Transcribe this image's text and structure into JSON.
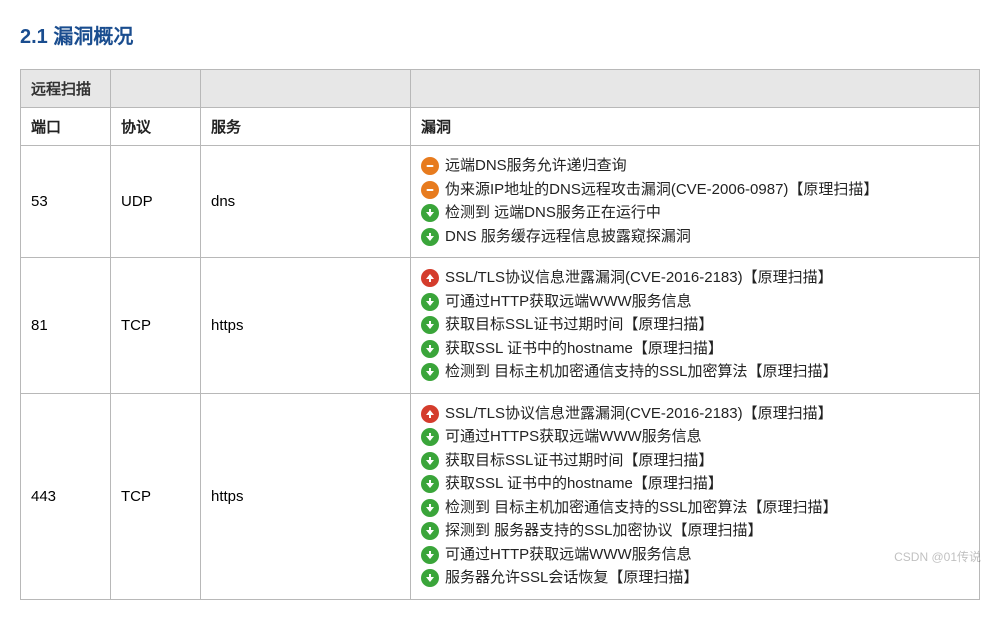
{
  "title": "2.1 漏洞概况",
  "headers": {
    "remote_scan": "远程扫描",
    "port": "端口",
    "protocol": "协议",
    "service": "服务",
    "vuln": "漏洞"
  },
  "rows": [
    {
      "port": "53",
      "protocol": "UDP",
      "service": "dns",
      "vulns": [
        {
          "sev": "orange",
          "text": "远端DNS服务允许递归查询"
        },
        {
          "sev": "orange",
          "text": "伪来源IP地址的DNS远程攻击漏洞(CVE-2006-0987)【原理扫描】"
        },
        {
          "sev": "green",
          "text": "检测到 远端DNS服务正在运行中"
        },
        {
          "sev": "green",
          "text": "DNS 服务缓存远程信息披露窥探漏洞"
        }
      ]
    },
    {
      "port": "81",
      "protocol": "TCP",
      "service": "https",
      "vulns": [
        {
          "sev": "red",
          "text": "SSL/TLS协议信息泄露漏洞(CVE-2016-2183)【原理扫描】"
        },
        {
          "sev": "green",
          "text": "可通过HTTP获取远端WWW服务信息"
        },
        {
          "sev": "green",
          "text": "获取目标SSL证书过期时间【原理扫描】"
        },
        {
          "sev": "green",
          "text": "获取SSL 证书中的hostname【原理扫描】"
        },
        {
          "sev": "green",
          "text": "检测到 目标主机加密通信支持的SSL加密算法【原理扫描】"
        }
      ]
    },
    {
      "port": "443",
      "protocol": "TCP",
      "service": "https",
      "vulns": [
        {
          "sev": "red",
          "text": "SSL/TLS协议信息泄露漏洞(CVE-2016-2183)【原理扫描】"
        },
        {
          "sev": "green",
          "text": "可通过HTTPS获取远端WWW服务信息"
        },
        {
          "sev": "green",
          "text": "获取目标SSL证书过期时间【原理扫描】"
        },
        {
          "sev": "green",
          "text": "获取SSL 证书中的hostname【原理扫描】"
        },
        {
          "sev": "green",
          "text": "检测到 目标主机加密通信支持的SSL加密算法【原理扫描】"
        },
        {
          "sev": "green",
          "text": "探测到 服务器支持的SSL加密协议【原理扫描】"
        },
        {
          "sev": "green",
          "text": "可通过HTTP获取远端WWW服务信息"
        },
        {
          "sev": "green",
          "text": "服务器允许SSL会话恢复【原理扫描】"
        }
      ]
    }
  ],
  "watermark": "CSDN @01传说"
}
